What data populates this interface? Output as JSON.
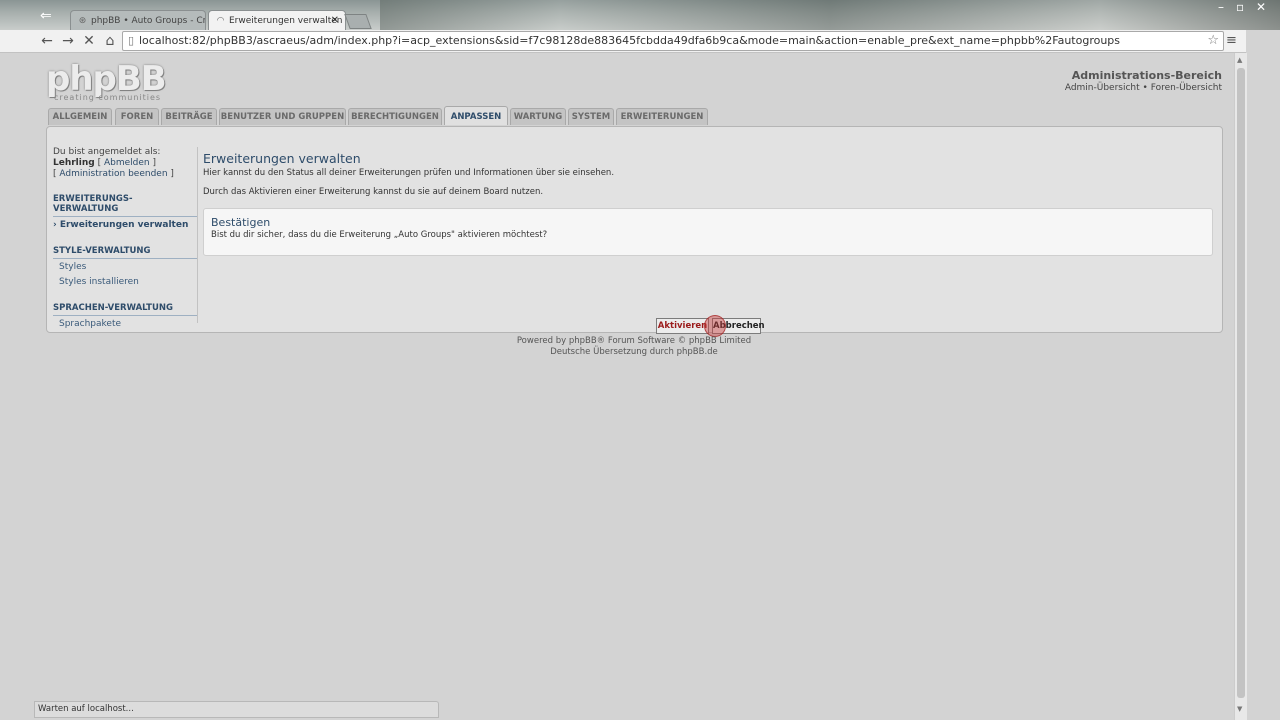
{
  "browser": {
    "tabs": [
      {
        "label": "phpBB • Auto Groups - Cr",
        "state": "inactive"
      },
      {
        "label": "Erweiterungen verwalten",
        "state": "active"
      }
    ],
    "url": "localhost:82/phpBB3/ascraeus/adm/index.php?i=acp_extensions&sid=f7c98128de883645fcbdda49dfa6b9ca&mode=main&action=enable_pre&ext_name=phpbb%2Fautogroups",
    "status": "Warten auf localhost..."
  },
  "header": {
    "logo": "phpBB",
    "logo_tagline": "creating communities",
    "admin_title": "Administrations-Bereich",
    "admin_overview": "Admin-Übersicht",
    "separator": "•",
    "forum_overview": "Foren-Übersicht"
  },
  "nav_tabs": [
    "ALLGEMEIN",
    "FOREN",
    "BEITRÄGE",
    "BENUTZER UND GRUPPEN",
    "BERECHTIGUNGEN",
    "ANPASSEN",
    "WARTUNG",
    "SYSTEM",
    "ERWEITERUNGEN"
  ],
  "active_tab": "ANPASSEN",
  "sidebar": {
    "logged_in_label": "Du bist angemeldet als:",
    "username": "Lehrling",
    "logout_link": "Abmelden",
    "exit_admin_link": "Administration beenden",
    "sections": [
      {
        "title": "ERWEITERUNGS-VERWALTUNG",
        "items": [
          "Erweiterungen verwalten"
        ]
      },
      {
        "title": "STYLE-VERWALTUNG",
        "items": [
          "Styles",
          "Styles installieren"
        ]
      },
      {
        "title": "SPRACHEN-VERWALTUNG",
        "items": [
          "Sprachpakete"
        ]
      }
    ]
  },
  "main": {
    "title": "Erweiterungen verwalten",
    "intro1": "Hier kannst du den Status all deiner Erweiterungen prüfen und Informationen über sie einsehen.",
    "intro2": "Durch das Aktivieren einer Erweiterung kannst du sie auf deinem Board nutzen.",
    "confirm_title": "Bestätigen",
    "confirm_question": "Bist du dir sicher, dass du die Erweiterung „Auto Groups\" aktivieren möchtest?",
    "confirm_button": "Aktivieren",
    "cancel_button": "Abbrechen"
  },
  "footer": {
    "line1": "Powered by phpBB® Forum Software © phpBB Limited",
    "line2": "Deutsche Übersetzung durch phpBB.de"
  },
  "colors": {
    "accent": "#2e4c6a",
    "page_bg": "#d3d3d3",
    "panel_bg": "#e2e2e2"
  }
}
